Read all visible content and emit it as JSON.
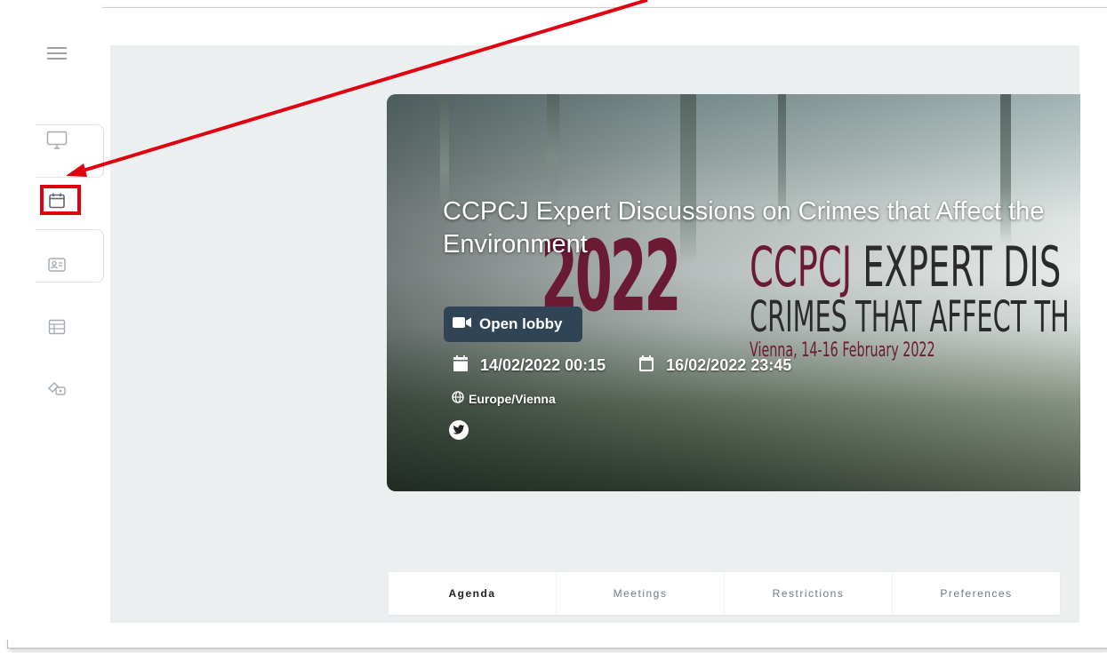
{
  "event": {
    "title": "CCPCJ Expert Discussions on Crimes that Affect the Environment",
    "open_lobby_label": "Open lobby",
    "start": "14/02/2022 00:15",
    "end": "16/02/2022 23:45",
    "timezone": "Europe/Vienna"
  },
  "poster": {
    "year": "2022",
    "line1_red": "CCPCJ",
    "line1_dark": " EXPERT DIS",
    "line2": "CRIMES THAT AFFECT TH",
    "line3": "Vienna, 14-16 February 2022"
  },
  "tabs": [
    "Agenda",
    "Meetings",
    "Restrictions",
    "Preferences"
  ],
  "active_tab": "Agenda",
  "sidebar": {
    "icons": [
      "menu-icon",
      "monitor-icon",
      "calendar-icon",
      "contact-card-icon",
      "table-icon",
      "tickets-icon"
    ],
    "selected": "calendar-icon"
  },
  "annotation": {
    "color": "#e0000f"
  },
  "colors": {
    "accent": "#2f4455",
    "content_bg": "#eceff0",
    "poster_red": "#6b1a33"
  }
}
